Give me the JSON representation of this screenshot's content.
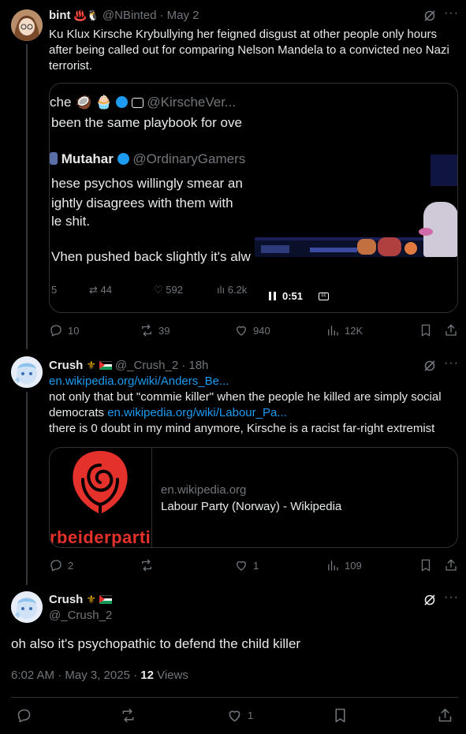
{
  "tweet1": {
    "name": "bint",
    "name_emojis": "♨️🐧",
    "handle": "@NBinted",
    "date": "· May 2",
    "text": "Ku Klux Kirsche Krybullying her feigned disgust at other people only hours after being called out for comparing Nelson Mandela to a convicted neo Nazi terrorist.",
    "quote": {
      "author": "che 🥥 🧁",
      "handle": "@KirscheVer...",
      "line1": "been the same playbook for ove",
      "inner_author": "Mutahar",
      "inner_handle": "@OrdinaryGamers",
      "inner_lines": [
        "hese psychos willingly smear an",
        "ightly disagrees with them with",
        "le shit.",
        "",
        "Vhen pushed back slightly it's alw"
      ],
      "stats": [
        "5",
        "44",
        "592",
        "6.2k"
      ],
      "video_time": "0:51"
    },
    "actions": {
      "replies": "10",
      "reposts": "39",
      "likes": "940",
      "views": "12K"
    }
  },
  "tweet2": {
    "name": "Crush",
    "handle": "@_Crush_2",
    "date": "· 18h",
    "link1": "en.wikipedia.org/wiki/Anders_Be...",
    "text1": "not only that but \"commie killer\" when the people he killed are simply social democrats",
    "link2": "en.wikipedia.org/wiki/Labour_Pa...",
    "text2": "there is 0 doubt in my mind anymore, Kirsche is a racist far-right extremist",
    "card": {
      "domain": "en.wikipedia.org",
      "title": "Labour Party (Norway) - Wikipedia",
      "image_text": "rbeiderpartie"
    },
    "actions": {
      "replies": "2",
      "reposts": "",
      "likes": "1",
      "views": "109"
    }
  },
  "tweet3": {
    "name": "Crush",
    "handle": "@_Crush_2",
    "text": "oh also it's psychopathic to defend the child killer",
    "timestamp": "6:02 AM · May 3, 2025 ·",
    "views_count": "12",
    "views_label": "Views",
    "actions": {
      "likes": "1"
    }
  },
  "colors": {
    "accent": "#1d9bf0",
    "muted": "#71767b",
    "divider": "#2f3336",
    "background": "#000000"
  }
}
